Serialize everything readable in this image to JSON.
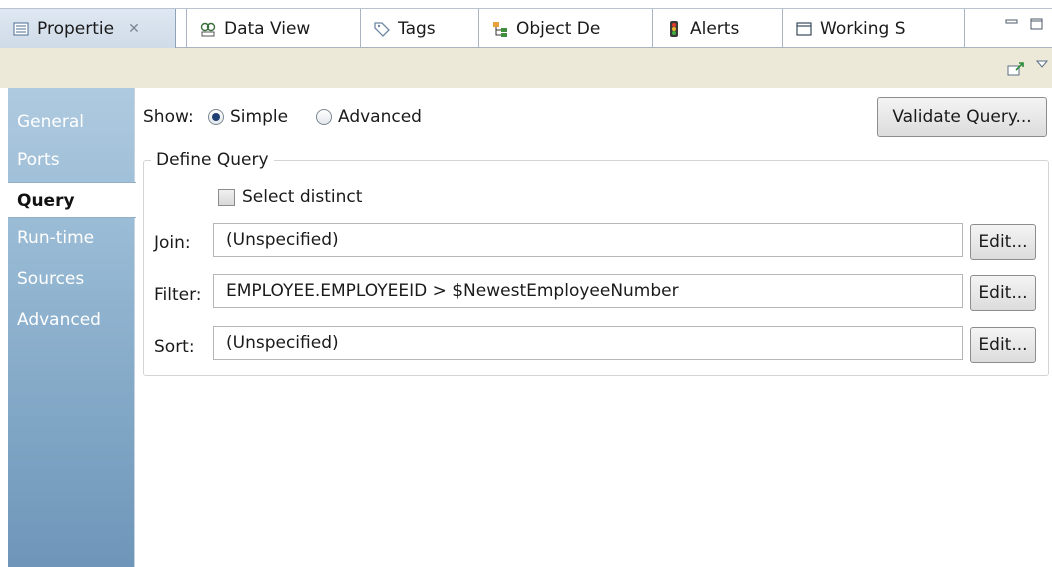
{
  "tabs": [
    {
      "label": "Propertie",
      "icon": "properties-icon"
    },
    {
      "label": "Data View",
      "icon": "data-view-icon"
    },
    {
      "label": "Tags",
      "icon": "tag-icon"
    },
    {
      "label": "Object De",
      "icon": "object-dependencies-icon"
    },
    {
      "label": "Alerts",
      "icon": "alert-icon"
    },
    {
      "label": "Working S",
      "icon": "window-icon"
    }
  ],
  "tab_close_glyph": "✕",
  "sidebar": {
    "items": [
      {
        "label": "General"
      },
      {
        "label": "Ports"
      },
      {
        "label": "Query"
      },
      {
        "label": "Run-time"
      },
      {
        "label": "Sources"
      },
      {
        "label": "Advanced"
      }
    ],
    "active_index": 2
  },
  "show": {
    "label": "Show:",
    "options": [
      "Simple",
      "Advanced"
    ],
    "selected": "Simple"
  },
  "validate_button": "Validate Query...",
  "define_query": {
    "title": "Define Query",
    "select_distinct_label": "Select distinct",
    "select_distinct_checked": false,
    "join_label": "Join:",
    "join_value": "(Unspecified)",
    "filter_label": "Filter:",
    "filter_value": "EMPLOYEE.EMPLOYEEID > $NewestEmployeeNumber",
    "sort_label": "Sort:",
    "sort_value": "(Unspecified)",
    "edit_label": "Edit..."
  },
  "colors": {
    "toolbar_bg": "#ede9d9",
    "nav_gradient_top": "#aecae0",
    "nav_gradient_bottom": "#6e96b9",
    "radio_selected": "#1d3f73"
  }
}
